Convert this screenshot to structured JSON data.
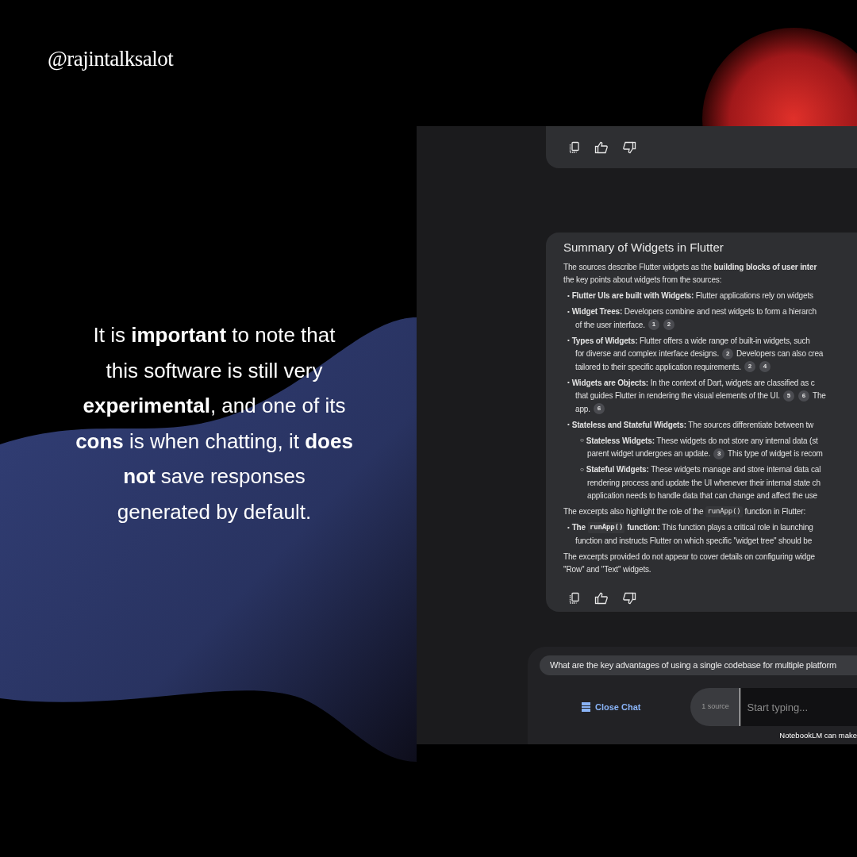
{
  "handle": "@rajintalksalot",
  "caption_lines": [
    "It is **important** to note that",
    "this software is still very",
    "**experimental**, and one of its",
    "**cons** is when chatting, it **does**",
    "**not** save responses",
    "generated by default."
  ],
  "summary_card": {
    "title": "Summary of Widgets in Flutter",
    "lines": [
      {
        "kind": "para",
        "parts": [
          {
            "kind": "text",
            "text": "The sources describe Flutter widgets as the **building blocks of user inter**"
          }
        ]
      },
      {
        "kind": "para",
        "parts": [
          {
            "kind": "text",
            "text": "the key points about widgets from the sources:"
          }
        ]
      },
      {
        "kind": "bullet",
        "marker": "•",
        "parts": [
          {
            "kind": "text",
            "text": "**Flutter UIs are built with Widgets:** Flutter applications rely on widgets"
          }
        ]
      },
      {
        "kind": "bullet",
        "marker": "•",
        "parts": [
          {
            "kind": "text",
            "text": "**Widget Trees:** Developers combine and nest widgets to form a hierarch"
          }
        ]
      },
      {
        "kind": "cont",
        "parts": [
          {
            "kind": "text",
            "text": "of the user interface."
          },
          {
            "kind": "cite",
            "text": "1"
          },
          {
            "kind": "cite",
            "text": "2"
          }
        ]
      },
      {
        "kind": "bullet",
        "marker": "•",
        "parts": [
          {
            "kind": "text",
            "text": "**Types of Widgets:** Flutter offers a wide range of built-in widgets, such"
          }
        ]
      },
      {
        "kind": "cont",
        "parts": [
          {
            "kind": "text",
            "text": "for diverse and complex interface designs."
          },
          {
            "kind": "cite",
            "text": "2"
          },
          {
            "kind": "text",
            "text": "Developers can also crea"
          }
        ]
      },
      {
        "kind": "cont",
        "parts": [
          {
            "kind": "text",
            "text": "tailored to their specific application requirements."
          },
          {
            "kind": "cite",
            "text": "2"
          },
          {
            "kind": "cite",
            "text": "4"
          }
        ]
      },
      {
        "kind": "bullet",
        "marker": "•",
        "parts": [
          {
            "kind": "text",
            "text": "**Widgets are Objects:** In the context of Dart, widgets are classified as c"
          }
        ]
      },
      {
        "kind": "cont",
        "parts": [
          {
            "kind": "text",
            "text": "that guides Flutter in rendering the visual elements of the UI."
          },
          {
            "kind": "cite",
            "text": "5"
          },
          {
            "kind": "cite",
            "text": "6"
          },
          {
            "kind": "text",
            "text": "The"
          }
        ]
      },
      {
        "kind": "cont",
        "parts": [
          {
            "kind": "text",
            "text": "app."
          },
          {
            "kind": "cite",
            "text": "6"
          }
        ]
      },
      {
        "kind": "bullet",
        "marker": "•",
        "parts": [
          {
            "kind": "text",
            "text": "**Stateless and Stateful Widgets:** The sources differentiate between tw"
          }
        ]
      },
      {
        "kind": "sub",
        "marker": "○",
        "parts": [
          {
            "kind": "text",
            "text": "**Stateless Widgets:** These widgets do not store any internal data (st"
          }
        ]
      },
      {
        "kind": "subcont",
        "parts": [
          {
            "kind": "text",
            "text": "parent widget undergoes an update."
          },
          {
            "kind": "cite",
            "text": "3"
          },
          {
            "kind": "text",
            "text": "This type of widget is recom"
          }
        ]
      },
      {
        "kind": "sub",
        "marker": "○",
        "parts": [
          {
            "kind": "text",
            "text": "**Stateful Widgets:** These widgets manage and store internal data cal"
          }
        ]
      },
      {
        "kind": "subcont",
        "parts": [
          {
            "kind": "text",
            "text": "rendering process and update the UI whenever their internal state ch"
          }
        ]
      },
      {
        "kind": "subcont",
        "parts": [
          {
            "kind": "text",
            "text": "application needs to handle data that can change and affect the use"
          }
        ]
      },
      {
        "kind": "para",
        "parts": [
          {
            "kind": "text",
            "text": "The excerpts also highlight the role of the"
          },
          {
            "kind": "code",
            "text": "runApp()"
          },
          {
            "kind": "text",
            "text": "function in Flutter:"
          }
        ]
      },
      {
        "kind": "bullet",
        "marker": "•",
        "parts": [
          {
            "kind": "text",
            "text": "**The**"
          },
          {
            "kind": "code_bold",
            "text": "runApp()"
          },
          {
            "kind": "text",
            "text": "**function:** This function plays a critical role in launching"
          }
        ]
      },
      {
        "kind": "cont",
        "parts": [
          {
            "kind": "text",
            "text": "function and instructs Flutter on which specific \"widget tree\" should be"
          }
        ]
      },
      {
        "kind": "para",
        "parts": [
          {
            "kind": "text",
            "text": "The excerpts provided do not appear to cover details on configuring widge"
          }
        ]
      },
      {
        "kind": "para",
        "parts": [
          {
            "kind": "text",
            "text": "\"Row\" and \"Text\" widgets."
          }
        ]
      }
    ]
  },
  "suggestion": "What are the key advantages of using a single codebase for multiple platform",
  "close_chat": "Close Chat",
  "source_count": "1 source",
  "input_placeholder": "Start typing...",
  "footer_note": "NotebookLM can make"
}
